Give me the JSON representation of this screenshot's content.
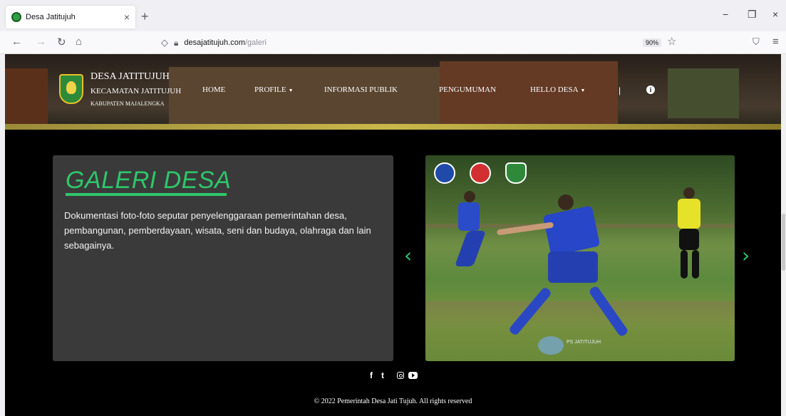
{
  "browser": {
    "tab_title": "Desa Jatitujuh",
    "tab_close": "×",
    "new_tab": "+",
    "url_host": "desajatitujuh.com",
    "url_path": "/galeri",
    "zoom": "90%",
    "window_minimize": "−",
    "window_restore": "❐",
    "window_close": "×"
  },
  "header": {
    "brand_line1": "DESA JATITUJUH",
    "brand_line2": "KECAMATAN JATITUJUH",
    "brand_line3": "KABUPATEN MAJALENGKA",
    "menu": {
      "home": "HOME",
      "profile": "PROFILE",
      "informasi": "INFORMASI PUBLIK",
      "pengumuman": "PENGUMUMAN",
      "hello": "HELLO DESA",
      "separator": "|"
    }
  },
  "gallery": {
    "title": "GALERI DESA",
    "description": "Dokumentasi foto-foto seputar penyelenggaraan pemerintahan desa, pembangunan, pemberdayaan, wisata, seni dan budaya, olahraga dan lain sebagainya.",
    "prev": "‹",
    "next": "›",
    "photo_watermark": "PS JATITUJUH"
  },
  "footer": {
    "facebook": "f",
    "twitter": "t",
    "copyright": "© 2022 Pemerintah Desa Jati Tujuh. All rights reserved"
  },
  "colors": {
    "accent": "#2ec76b",
    "card_bg": "#3a3a3a",
    "page_bg": "#000000"
  }
}
